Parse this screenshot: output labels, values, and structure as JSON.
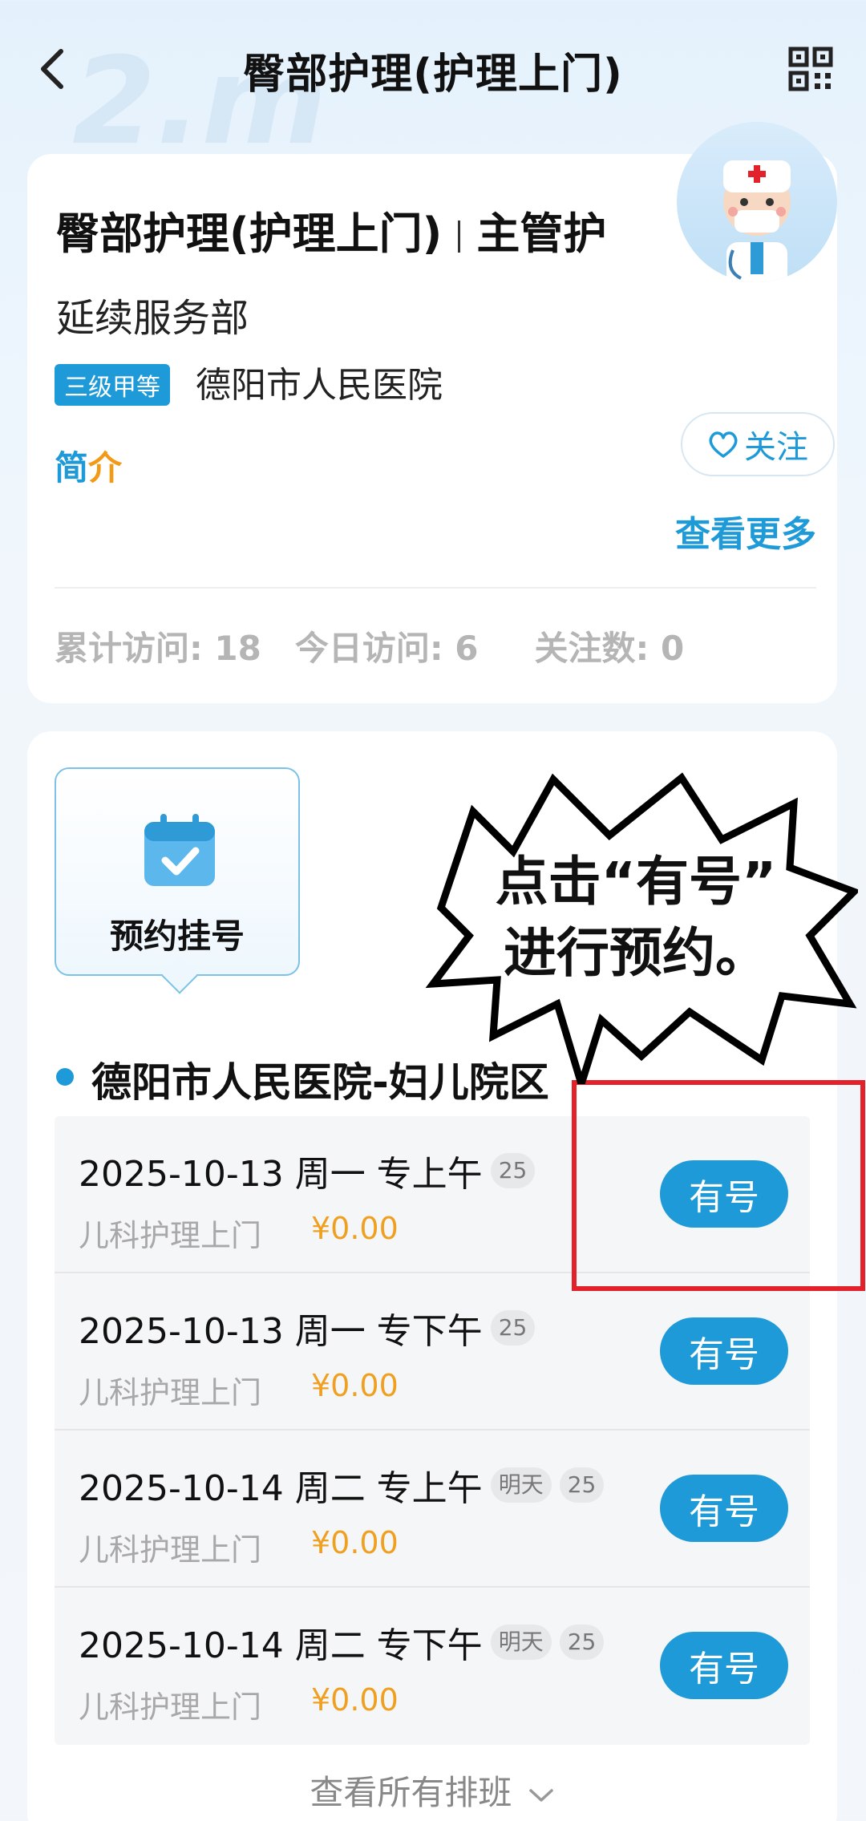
{
  "header": {
    "title": "臀部护理(护理上门)"
  },
  "doctor": {
    "name": "臀部护理(护理上门)",
    "role": "主管护",
    "follow_label": "关注",
    "department": "延续服务部",
    "level": "三级甲等",
    "hospital": "德阳市人民医院",
    "intro_label_a": "简",
    "intro_label_b": "介",
    "more": "查看更多",
    "stats": {
      "total_visits": "累计访问: 18",
      "today_visits": "今日访问: 6",
      "followers": "关注数: 0"
    }
  },
  "booking": {
    "tab_label": "预约挂号",
    "location": "德阳市人民医院-妇儿院区",
    "slots": [
      {
        "date": "2025-10-13 周一 专上午",
        "tag": "",
        "count": "25",
        "type": "儿科护理上门",
        "price": "¥0.00",
        "button": "有号"
      },
      {
        "date": "2025-10-13 周一 专下午",
        "tag": "",
        "count": "25",
        "type": "儿科护理上门",
        "price": "¥0.00",
        "button": "有号"
      },
      {
        "date": "2025-10-14 周二 专上午",
        "tag": "明天",
        "count": "25",
        "type": "儿科护理上门",
        "price": "¥0.00",
        "button": "有号"
      },
      {
        "date": "2025-10-14 周二 专下午",
        "tag": "明天",
        "count": "25",
        "type": "儿科护理上门",
        "price": "¥0.00",
        "button": "有号"
      }
    ],
    "view_all": "查看所有排班"
  },
  "annotation": {
    "line1": "点击“有号”",
    "line2": "进行预约。"
  },
  "colors": {
    "accent": "#1f9ad8",
    "price": "#f0a020",
    "highlight": "#e3212b"
  }
}
